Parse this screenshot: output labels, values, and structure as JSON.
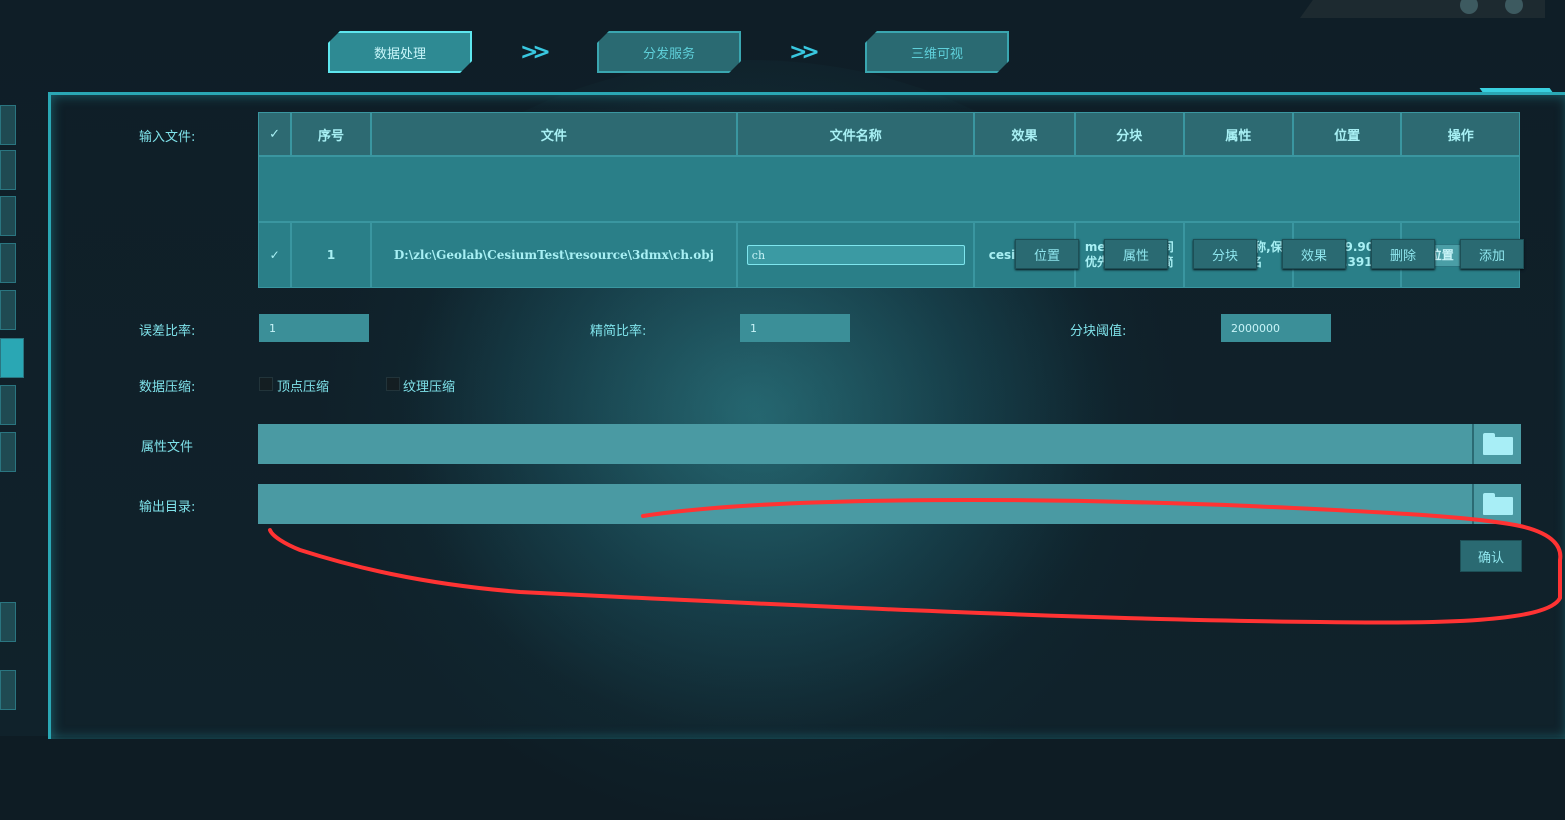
{
  "steps": {
    "step1": "数据处理",
    "step2": "分发服务",
    "step3": "三维可视",
    "arrow": ">>"
  },
  "labels": {
    "input_file": "输入文件:",
    "error_ratio": "误差比率:",
    "simplify_ratio": "精简比率:",
    "tile_threshold": "分块阈值:",
    "compression": "数据压缩:",
    "attr_file": "属性文件",
    "output_dir": "输出目录:"
  },
  "table": {
    "headers": [
      "✓",
      "序号",
      "文件",
      "文件名称",
      "效果",
      "分块",
      "属性",
      "位置",
      "操作"
    ],
    "rows": [
      {
        "check": "✓",
        "index": "1",
        "file": "D:\\zlc\\Geolab\\CesiumTest\\resource\\3dmx\\ch.obj",
        "name": "ch",
        "effect": "cesium默认",
        "tile": "mesh分块,空间优先,合并后精简",
        "attr": "保存文件名称,保存对象名",
        "position": "ENU:39.90691,116.39123",
        "op_position": "位置",
        "op_delete": "删除"
      }
    ]
  },
  "actions": [
    "位置",
    "属性",
    "分块",
    "效果",
    "删除",
    "添加"
  ],
  "params": {
    "error_ratio": "1",
    "simplify_ratio": "1",
    "tile_threshold": "2000000"
  },
  "compression": {
    "vertex": "顶点压缩",
    "texture": "纹理压缩"
  },
  "confirm": "确认",
  "colors": {
    "accent": "#2aa7b4",
    "annotation": "#ff3333"
  }
}
